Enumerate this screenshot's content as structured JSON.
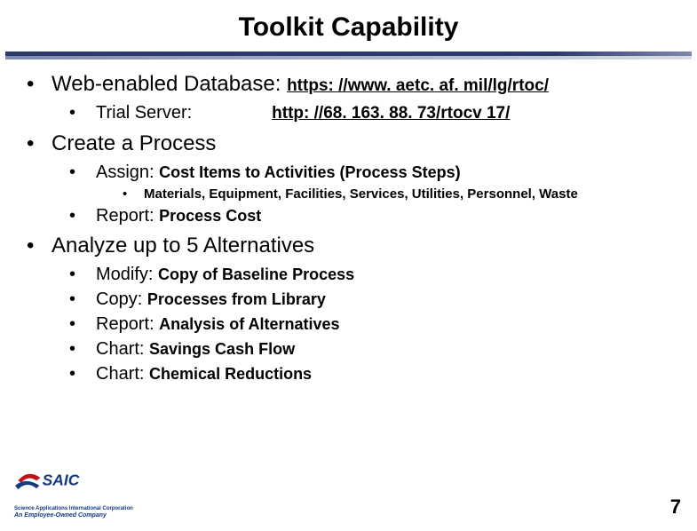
{
  "title": "Toolkit Capability",
  "page_number": "7",
  "bullets": {
    "web": {
      "label_prefix": "Web-enabled Database: ",
      "url": "https: //www. aetc. af. mil/lg/rtoc/",
      "trial": {
        "label": "Trial Server:",
        "url": "http: //68. 163. 88. 73/rtocv 17/"
      }
    },
    "create": {
      "label": "Create a Process",
      "assign": {
        "prefix": "Assign: ",
        "rest": "Cost Items to Activities (Process Steps)",
        "sub": "Materials, Equipment, Facilities, Services, Utilities, Personnel, Waste"
      },
      "report": {
        "prefix": "Report: ",
        "rest": "Process Cost"
      }
    },
    "analyze": {
      "label": "Analyze up to 5 Alternatives",
      "items": [
        {
          "prefix": "Modify: ",
          "rest": "Copy of Baseline Process"
        },
        {
          "prefix": "Copy: ",
          "rest": "Processes from Library"
        },
        {
          "prefix": "Report: ",
          "rest": "Analysis of Alternatives"
        },
        {
          "prefix": "Chart: ",
          "rest": "Savings Cash Flow"
        },
        {
          "prefix": "Chart: ",
          "rest": "Chemical Reductions"
        }
      ]
    }
  },
  "footer": {
    "company_initials": "SAIC",
    "company_full": "Science Applications International Corporation",
    "tagline": "An Employee-Owned Company"
  }
}
